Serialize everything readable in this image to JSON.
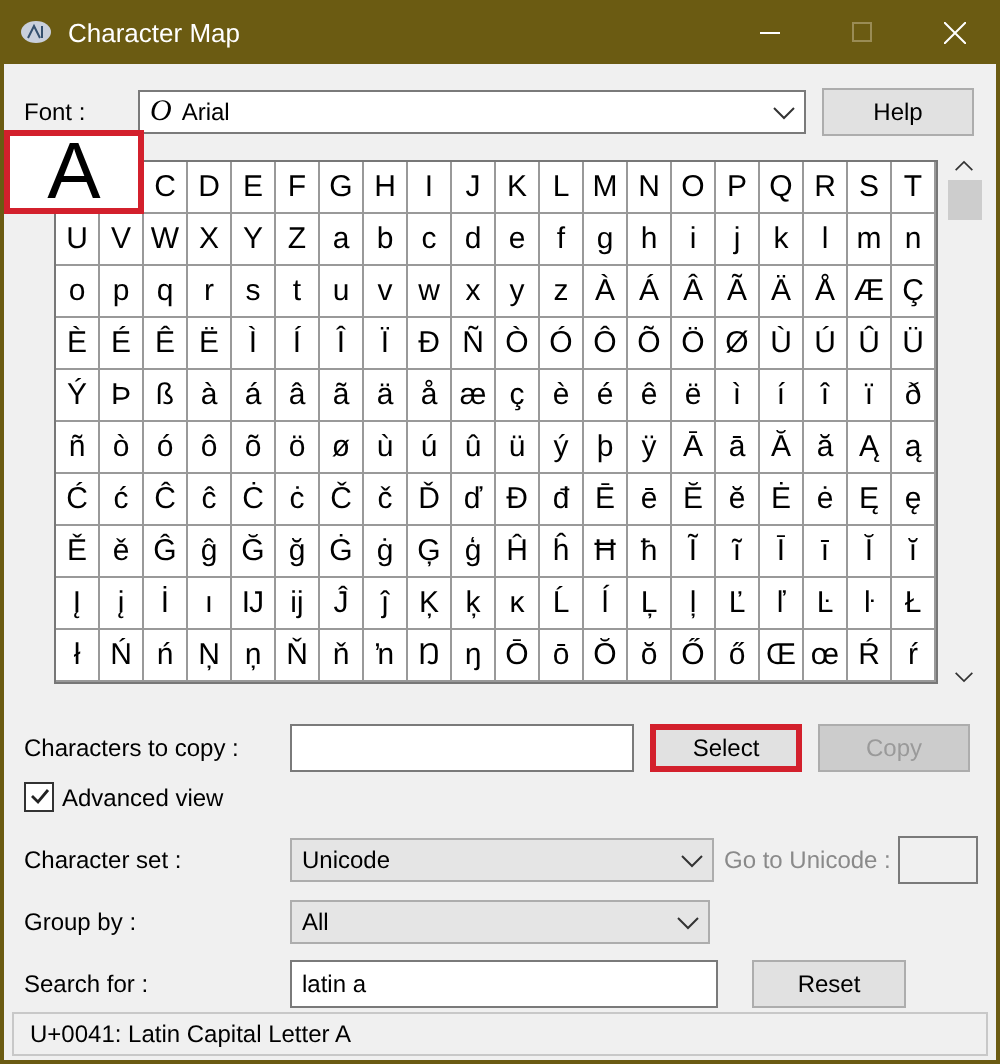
{
  "window": {
    "title": "Character Map"
  },
  "font": {
    "label": "Font :",
    "value": "Arial",
    "glyph": "O"
  },
  "help_button": {
    "label": "Help"
  },
  "magnifier": {
    "char": "A"
  },
  "grid": {
    "rows": [
      [
        null,
        null,
        "C",
        "D",
        "E",
        "F",
        "G",
        "H",
        "I",
        "J",
        "K",
        "L",
        "M",
        "N",
        "O",
        "P",
        "Q",
        "R",
        "S",
        "T"
      ],
      [
        "U",
        "V",
        "W",
        "X",
        "Y",
        "Z",
        "a",
        "b",
        "c",
        "d",
        "e",
        "f",
        "g",
        "h",
        "i",
        "j",
        "k",
        "l",
        "m",
        "n"
      ],
      [
        "o",
        "p",
        "q",
        "r",
        "s",
        "t",
        "u",
        "v",
        "w",
        "x",
        "y",
        "z",
        "À",
        "Á",
        "Â",
        "Ã",
        "Ä",
        "Å",
        "Æ",
        "Ç"
      ],
      [
        "È",
        "É",
        "Ê",
        "Ë",
        "Ì",
        "Í",
        "Î",
        "Ï",
        "Ð",
        "Ñ",
        "Ò",
        "Ó",
        "Ô",
        "Õ",
        "Ö",
        "Ø",
        "Ù",
        "Ú",
        "Û",
        "Ü"
      ],
      [
        "Ý",
        "Þ",
        "ß",
        "à",
        "á",
        "â",
        "ã",
        "ä",
        "å",
        "æ",
        "ç",
        "è",
        "é",
        "ê",
        "ë",
        "ì",
        "í",
        "î",
        "ï",
        "ð"
      ],
      [
        "ñ",
        "ò",
        "ó",
        "ô",
        "õ",
        "ö",
        "ø",
        "ù",
        "ú",
        "û",
        "ü",
        "ý",
        "þ",
        "ÿ",
        "Ā",
        "ā",
        "Ă",
        "ă",
        "Ą",
        "ą"
      ],
      [
        "Ć",
        "ć",
        "Ĉ",
        "ĉ",
        "Ċ",
        "ċ",
        "Č",
        "č",
        "Ď",
        "ď",
        "Đ",
        "đ",
        "Ē",
        "ē",
        "Ĕ",
        "ĕ",
        "Ė",
        "ė",
        "Ę",
        "ę"
      ],
      [
        "Ě",
        "ě",
        "Ĝ",
        "ĝ",
        "Ğ",
        "ğ",
        "Ġ",
        "ġ",
        "Ģ",
        "ģ",
        "Ĥ",
        "ĥ",
        "Ħ",
        "ħ",
        "Ĩ",
        "ĩ",
        "Ī",
        "ī",
        "Ĭ",
        "ĭ"
      ],
      [
        "Į",
        "į",
        "İ",
        "ı",
        "Ĳ",
        "ĳ",
        "Ĵ",
        "ĵ",
        "Ķ",
        "ķ",
        "ĸ",
        "Ĺ",
        "ĺ",
        "Ļ",
        "ļ",
        "Ľ",
        "ľ",
        "Ŀ",
        "ŀ",
        "Ł"
      ],
      [
        "ł",
        "Ń",
        "ń",
        "Ņ",
        "ņ",
        "Ň",
        "ň",
        "ŉ",
        "Ŋ",
        "ŋ",
        "Ō",
        "ō",
        "Ŏ",
        "ŏ",
        "Ő",
        "ő",
        "Œ",
        "œ",
        "Ŕ",
        "ŕ"
      ]
    ]
  },
  "copy_row": {
    "label": "Characters to copy :",
    "select": {
      "label": "Select",
      "highlighted": true,
      "disabled": false
    },
    "copy": {
      "label": "Copy",
      "highlighted": false,
      "disabled": true
    }
  },
  "advanced_view": {
    "label": "Advanced view",
    "checked": true
  },
  "character_set": {
    "label": "Character set :",
    "value": "Unicode"
  },
  "go_to_unicode": {
    "label": "Go to Unicode :",
    "disabled": true
  },
  "group_by": {
    "label": "Group by :",
    "value": "All"
  },
  "search": {
    "label": "Search for :",
    "value": "latin a",
    "button": "Reset"
  },
  "status_bar": "U+0041: Latin Capital Letter A"
}
